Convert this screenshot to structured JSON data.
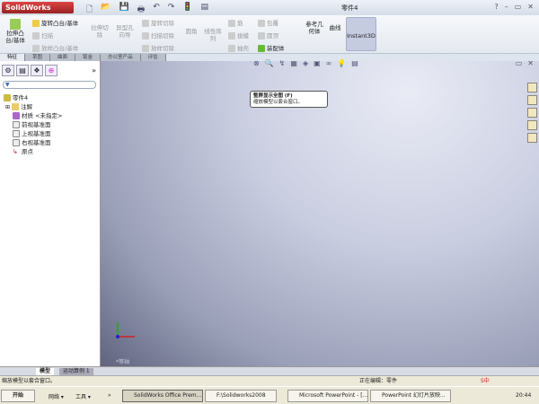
{
  "app": {
    "logo": "SolidWorks",
    "window_title": "零件4",
    "help": "?",
    "minimize": "–",
    "restore": "▭",
    "close": "✕"
  },
  "quick_access": [
    "🗋",
    "📂",
    "💾",
    "🖶",
    "↶",
    "↷",
    "🚦",
    "▤"
  ],
  "ribbon": {
    "extrude_boss": "拉伸凸台/基体",
    "revolve_boss": "旋转凸台/基体",
    "sweep": "扫描",
    "loft_boss": "放样凸台/基体",
    "extrude_cut": "拉伸切除",
    "hole_wizard": "异型孔向导",
    "revolve_cut": "旋转切除",
    "sweep_cut": "扫描切除",
    "loft_cut": "放样切除",
    "fillet": "圆角",
    "linear_pattern": "线性阵列",
    "rib": "筋",
    "draft": "拔模",
    "shell": "抽壳",
    "wrap": "包覆",
    "dome": "圆顶",
    "mirror": "镜向",
    "features_assembly": "装配体",
    "ref_geometry": "参考几何体",
    "curves": "曲线",
    "instant3d": "Instant3D"
  },
  "tabs": [
    {
      "label": "特征",
      "active": true
    },
    {
      "label": "草图"
    },
    {
      "label": "曲面"
    },
    {
      "label": "钣金"
    },
    {
      "label": "办公室产品"
    },
    {
      "label": "评估"
    }
  ],
  "panel": {
    "expand": "»",
    "filter_icon": "funnel-icon",
    "tree": [
      {
        "label": "零件4",
        "icon": "part-icon"
      },
      {
        "label": "注解",
        "icon": "annotation-icon"
      },
      {
        "label": "材质 <未指定>",
        "icon": "material-icon"
      },
      {
        "label": "前视基准面",
        "icon": "plane-icon"
      },
      {
        "label": "上视基准面",
        "icon": "plane-icon"
      },
      {
        "label": "右视基准面",
        "icon": "plane-icon"
      },
      {
        "label": "原点",
        "icon": "origin-icon"
      }
    ]
  },
  "view_toolbar": [
    "⊗",
    "🔍",
    "↯",
    "▦",
    "◈",
    "▣",
    "∞",
    "💡",
    "▤"
  ],
  "view_controls": {
    "restore": "▭",
    "close": "✕"
  },
  "tooltip": {
    "title": "整屏显示全图 (F)",
    "desc": "缩放模型以套合窗口。"
  },
  "view_label": "*等轴",
  "bottom_tabs": [
    {
      "label": "模型",
      "active": true
    },
    {
      "label": "运动算例 1"
    }
  ],
  "status": {
    "left": "缩放模型以套合窗口。",
    "editing": "正在编辑：零件"
  },
  "taskbar": {
    "start": "开始",
    "network": "网络 ▾",
    "tools": "工具 ▾",
    "more": "»",
    "items": [
      {
        "label": "SolidWorks Office Prem...",
        "active": true
      },
      {
        "label": "F:\\Solidworks2008"
      },
      {
        "label": "Microsoft PowerPoint - [..."
      },
      {
        "label": "PowerPoint 幻灯片放映..."
      }
    ],
    "clock": "20:44",
    "ime": "S中"
  }
}
